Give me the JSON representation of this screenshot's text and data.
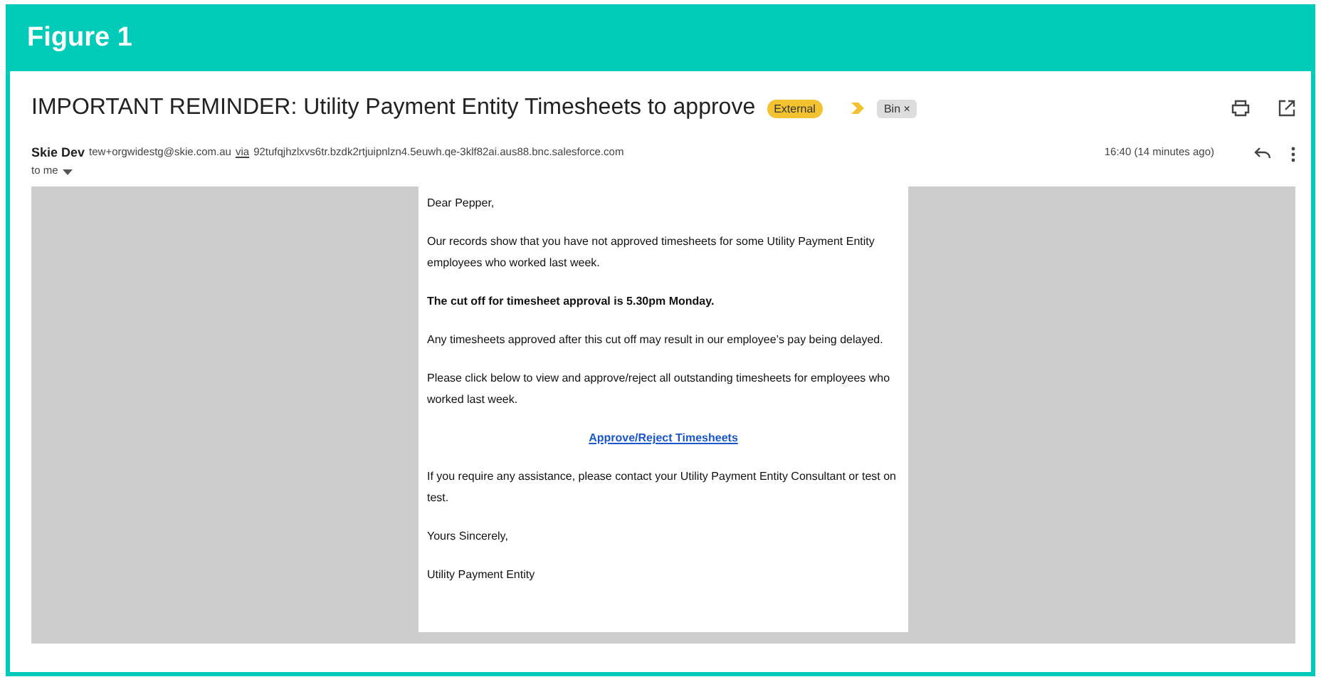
{
  "figure_title": "Figure 1",
  "email": {
    "subject": "IMPORTANT REMINDER: Utility Payment Entity Timesheets to approve",
    "labels": [
      {
        "text": "External",
        "kind": "external"
      },
      {
        "text": "Bin",
        "kind": "removable",
        "remove": "×"
      }
    ],
    "sender": {
      "name": "Skie Dev",
      "address": "tew+orgwidestg@skie.com.au",
      "via": "via",
      "via_domain": "92tufqjhzlxvs6tr.bzdk2rtjuipnlzn4.5euwh.qe-3klf82ai.aus88.bnc.salesforce.com"
    },
    "recipient": "to me",
    "time": "16:40 (14 minutes ago)",
    "body": [
      {
        "kind": "text",
        "text": "Dear Pepper,"
      },
      {
        "kind": "text",
        "text": "Our records show that you have not approved timesheets for some Utility Payment Entity employees who worked last week."
      },
      {
        "kind": "bold",
        "text": "The cut off for timesheet approval is 5.30pm Monday."
      },
      {
        "kind": "text",
        "text": "Any timesheets approved after this cut off may result in our employee’s pay being delayed."
      },
      {
        "kind": "text",
        "text": "Please click below to view and approve/reject all outstanding timesheets for employees who worked last week."
      },
      {
        "kind": "link",
        "text": "Approve/Reject Timesheets"
      },
      {
        "kind": "text",
        "text": "If you require any assistance, please contact your Utility Payment Entity Consultant or test on test."
      },
      {
        "kind": "text",
        "text": "Yours Sincerely,"
      },
      {
        "kind": "text",
        "text": "Utility Payment Entity"
      }
    ]
  }
}
